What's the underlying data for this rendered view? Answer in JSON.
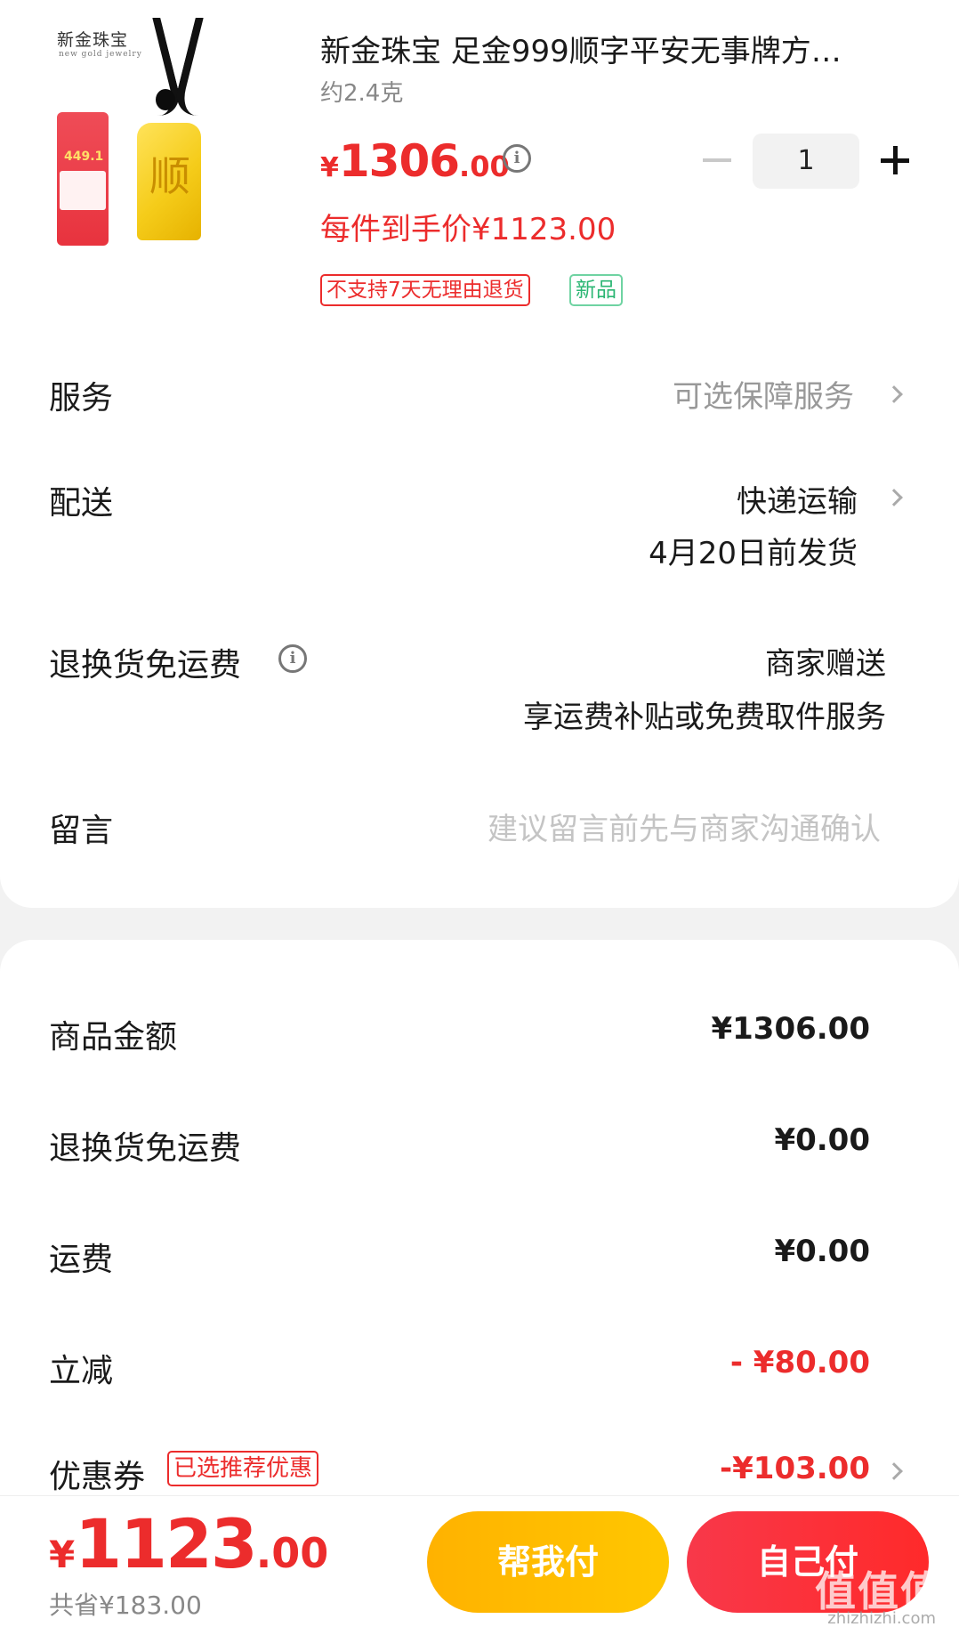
{
  "product": {
    "image_brand": "新金珠宝",
    "image_brand_sub": "new gold jewelry",
    "image_promo_price": "449.1",
    "title": "新金珠宝 足金999顺字平安无事牌方…",
    "weight": "约2.4克",
    "price_currency": "¥",
    "price_int": "1306",
    "price_dec": ".00",
    "quantity": "1",
    "deal_price": "每件到手价¥1123.00",
    "tag_no_return": "不支持7天无理由退货",
    "tag_new": "新品",
    "pendant_glyph": "顺"
  },
  "rows": {
    "service_label": "服务",
    "service_value": "可选保障服务",
    "delivery_label": "配送",
    "delivery_value": "快递运输",
    "delivery_date": "4月20日前发货",
    "return_label": "退换货免运费",
    "return_value": "商家赠送",
    "return_sub": "享运费补贴或免费取件服务",
    "message_label": "留言",
    "message_placeholder": "建议留言前先与商家沟通确认"
  },
  "summary": {
    "goods_label": "商品金额",
    "goods_value": "¥1306.00",
    "return_label": "退换货免运费",
    "return_value": "¥0.00",
    "shipping_label": "运费",
    "shipping_value": "¥0.00",
    "discount_label": "立减",
    "discount_value": "- ¥80.00",
    "coupon_label": "优惠券",
    "coupon_tag": "已选推荐优惠",
    "coupon_value": "-¥103.00"
  },
  "footer": {
    "total_currency": "¥",
    "total_int": "1123",
    "total_dec": ".00",
    "saved": "共省¥183.00",
    "help_pay": "帮我付",
    "self_pay": "自己付",
    "watermark": "值值值",
    "watermark_sub": "zhizhizhi.com"
  },
  "colors": {
    "accent_red": "#ec2c2c",
    "help_button": "#ffb200",
    "new_tag_green": "#2bb673"
  },
  "icons": [
    "info-icon",
    "minus-icon",
    "plus-icon",
    "chevron-right-icon"
  ]
}
